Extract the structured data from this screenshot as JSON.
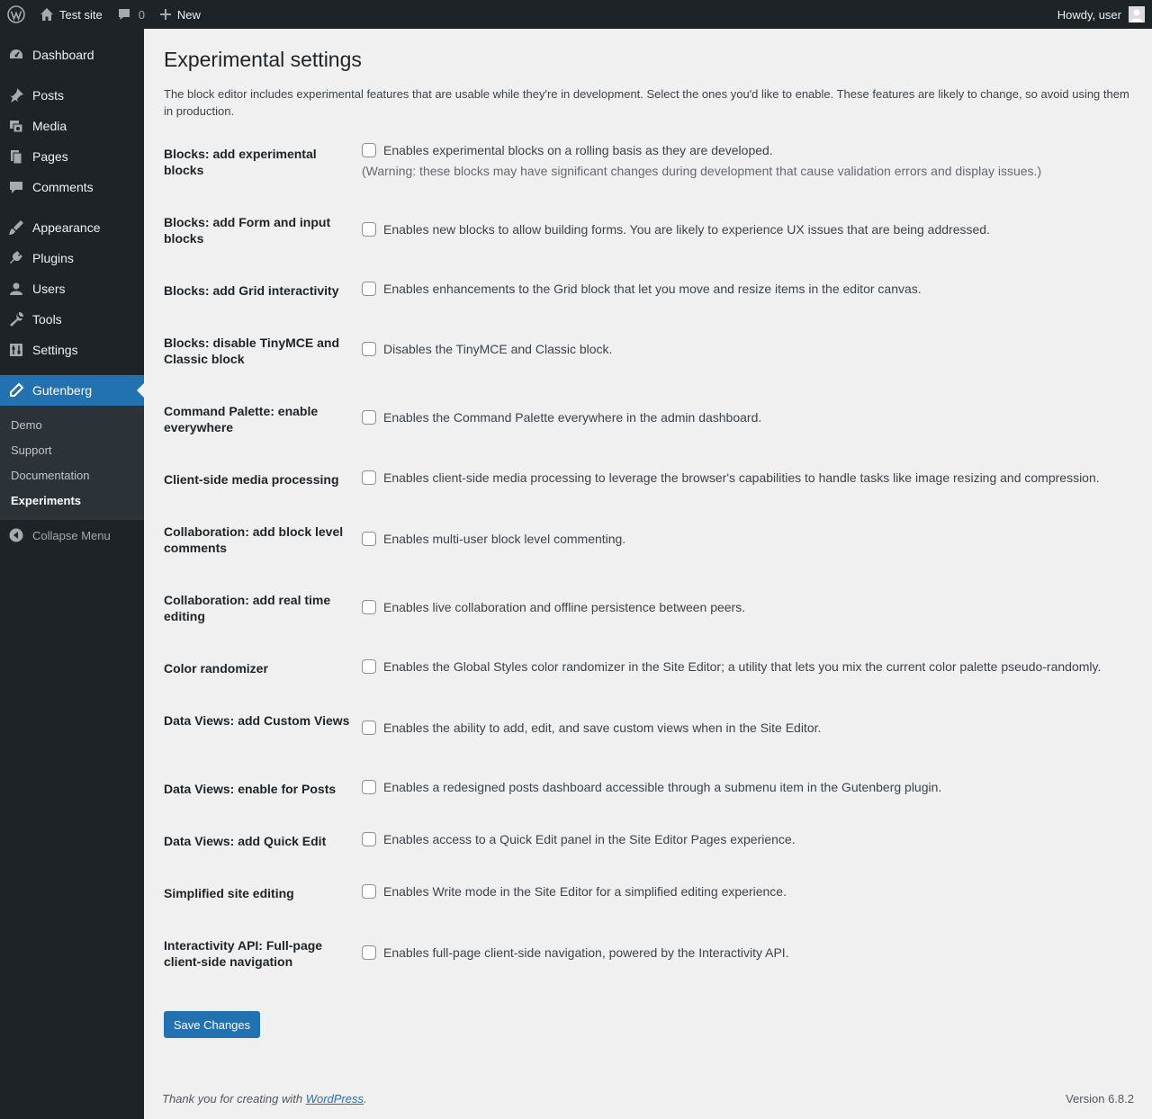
{
  "adminbar": {
    "site_name": "Test site",
    "comments_count": "0",
    "new_label": "New",
    "howdy": "Howdy, user"
  },
  "menu": {
    "items": [
      {
        "label": "Dashboard",
        "icon": "dashboard-icon"
      },
      {
        "label": "Posts",
        "icon": "pin-icon"
      },
      {
        "label": "Media",
        "icon": "media-icon"
      },
      {
        "label": "Pages",
        "icon": "pages-icon"
      },
      {
        "label": "Comments",
        "icon": "comments-icon"
      },
      {
        "label": "Appearance",
        "icon": "brush-icon"
      },
      {
        "label": "Plugins",
        "icon": "plug-icon"
      },
      {
        "label": "Users",
        "icon": "user-icon"
      },
      {
        "label": "Tools",
        "icon": "wrench-icon"
      },
      {
        "label": "Settings",
        "icon": "settings-icon"
      },
      {
        "label": "Gutenberg",
        "icon": "pencil-icon"
      }
    ],
    "submenu": [
      "Demo",
      "Support",
      "Documentation",
      "Experiments"
    ],
    "collapse": "Collapse Menu"
  },
  "page": {
    "title": "Experimental settings",
    "intro": "The block editor includes experimental features that are usable while they're in development. Select the ones you'd like to enable. These features are likely to change, so avoid using them in production.",
    "settings": [
      {
        "label": "Blocks: add experimental blocks",
        "desc": "Enables experimental blocks on a rolling basis as they are developed.",
        "note": "(Warning: these blocks may have significant changes during development that cause validation errors and display issues.)"
      },
      {
        "label": "Blocks: add Form and input blocks",
        "desc": "Enables new blocks to allow building forms. You are likely to experience UX issues that are being addressed."
      },
      {
        "label": "Blocks: add Grid interactivity",
        "desc": "Enables enhancements to the Grid block that let you move and resize items in the editor canvas."
      },
      {
        "label": "Blocks: disable TinyMCE and Classic block",
        "desc": "Disables the TinyMCE and Classic block."
      },
      {
        "label": "Command Palette: enable everywhere",
        "desc": "Enables the Command Palette everywhere in the admin dashboard."
      },
      {
        "label": "Client-side media processing",
        "desc": "Enables client-side media processing to leverage the browser's capabilities to handle tasks like image resizing and compression."
      },
      {
        "label": "Collaboration: add block level comments",
        "desc": "Enables multi-user block level commenting."
      },
      {
        "label": "Collaboration: add real time editing",
        "desc": "Enables live collaboration and offline persistence between peers."
      },
      {
        "label": "Color randomizer",
        "desc": "Enables the Global Styles color randomizer in the Site Editor; a utility that lets you mix the current color palette pseudo-randomly."
      },
      {
        "label": "Data Views: add Custom Views",
        "desc": "Enables the ability to add, edit, and save custom views when in the Site Editor."
      },
      {
        "label": "Data Views: enable for Posts",
        "desc": "Enables a redesigned posts dashboard accessible through a submenu item in the Gutenberg plugin."
      },
      {
        "label": "Data Views: add Quick Edit",
        "desc": "Enables access to a Quick Edit panel in the Site Editor Pages experience."
      },
      {
        "label": "Simplified site editing",
        "desc": "Enables Write mode in the Site Editor for a simplified editing experience."
      },
      {
        "label": "Interactivity API: Full-page client-side navigation",
        "desc": "Enables full-page client-side navigation, powered by the Interactivity API."
      }
    ],
    "save_label": "Save Changes"
  },
  "footer": {
    "thanks_prefix": "Thank you for creating with ",
    "thanks_link": "WordPress",
    "thanks_suffix": ".",
    "version": "Version 6.8.2"
  },
  "colors": {
    "accent": "#2271b1",
    "adminbar": "#1d2327",
    "submenu": "#2c3338",
    "background": "#f0f0f1"
  }
}
